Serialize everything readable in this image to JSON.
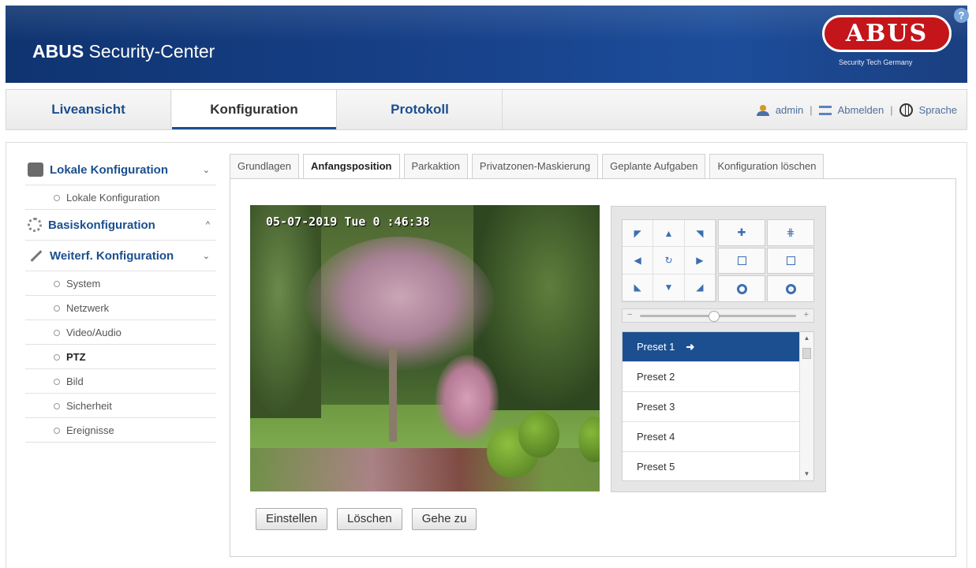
{
  "header": {
    "title_bold": "ABUS",
    "title_rest": " Security-Center",
    "logo_text": "ABUS",
    "logo_subtitle": "Security Tech Germany",
    "help_label": "?"
  },
  "topnav": {
    "tabs": [
      {
        "label": "Liveansicht"
      },
      {
        "label": "Konfiguration"
      },
      {
        "label": "Protokoll"
      }
    ],
    "active_tab": "Konfiguration",
    "user": "admin",
    "logout": "Abmelden",
    "language": "Sprache",
    "separator": "|"
  },
  "sidebar": {
    "groups": [
      {
        "label": "Lokale Konfiguration",
        "chevron": "⌄",
        "items": [
          {
            "label": "Lokale Konfiguration"
          }
        ]
      },
      {
        "label": "Basiskonfiguration",
        "chevron": "^",
        "items": []
      },
      {
        "label": "Weiterf. Konfiguration",
        "chevron": "⌄",
        "items": [
          {
            "label": "System"
          },
          {
            "label": "Netzwerk"
          },
          {
            "label": "Video/Audio"
          },
          {
            "label": "PTZ"
          },
          {
            "label": "Bild"
          },
          {
            "label": "Sicherheit"
          },
          {
            "label": "Ereignisse"
          }
        ]
      }
    ],
    "active_item": "PTZ"
  },
  "subtabs": [
    {
      "label": "Grundlagen"
    },
    {
      "label": "Anfangsposition"
    },
    {
      "label": "Parkaktion"
    },
    {
      "label": "Privatzonen-Maskierung"
    },
    {
      "label": "Geplante Aufgaben"
    },
    {
      "label": "Konfiguration löschen"
    }
  ],
  "active_subtab": "Anfangsposition",
  "video": {
    "osd_text": "05-07-2019 Tue 0 :46:38"
  },
  "ptz": {
    "zoom_level": 0.47,
    "presets": [
      {
        "label": "Preset 1"
      },
      {
        "label": "Preset 2"
      },
      {
        "label": "Preset 3"
      },
      {
        "label": "Preset 4"
      },
      {
        "label": "Preset 5"
      }
    ],
    "selected_preset": "Preset 1",
    "go_arrow": "➜"
  },
  "buttons": {
    "set": "Einstellen",
    "delete": "Löschen",
    "goto": "Gehe zu"
  },
  "colors": {
    "accent": "#1b4f8f",
    "banner": "#163f86",
    "logo_red": "#c4151b"
  }
}
